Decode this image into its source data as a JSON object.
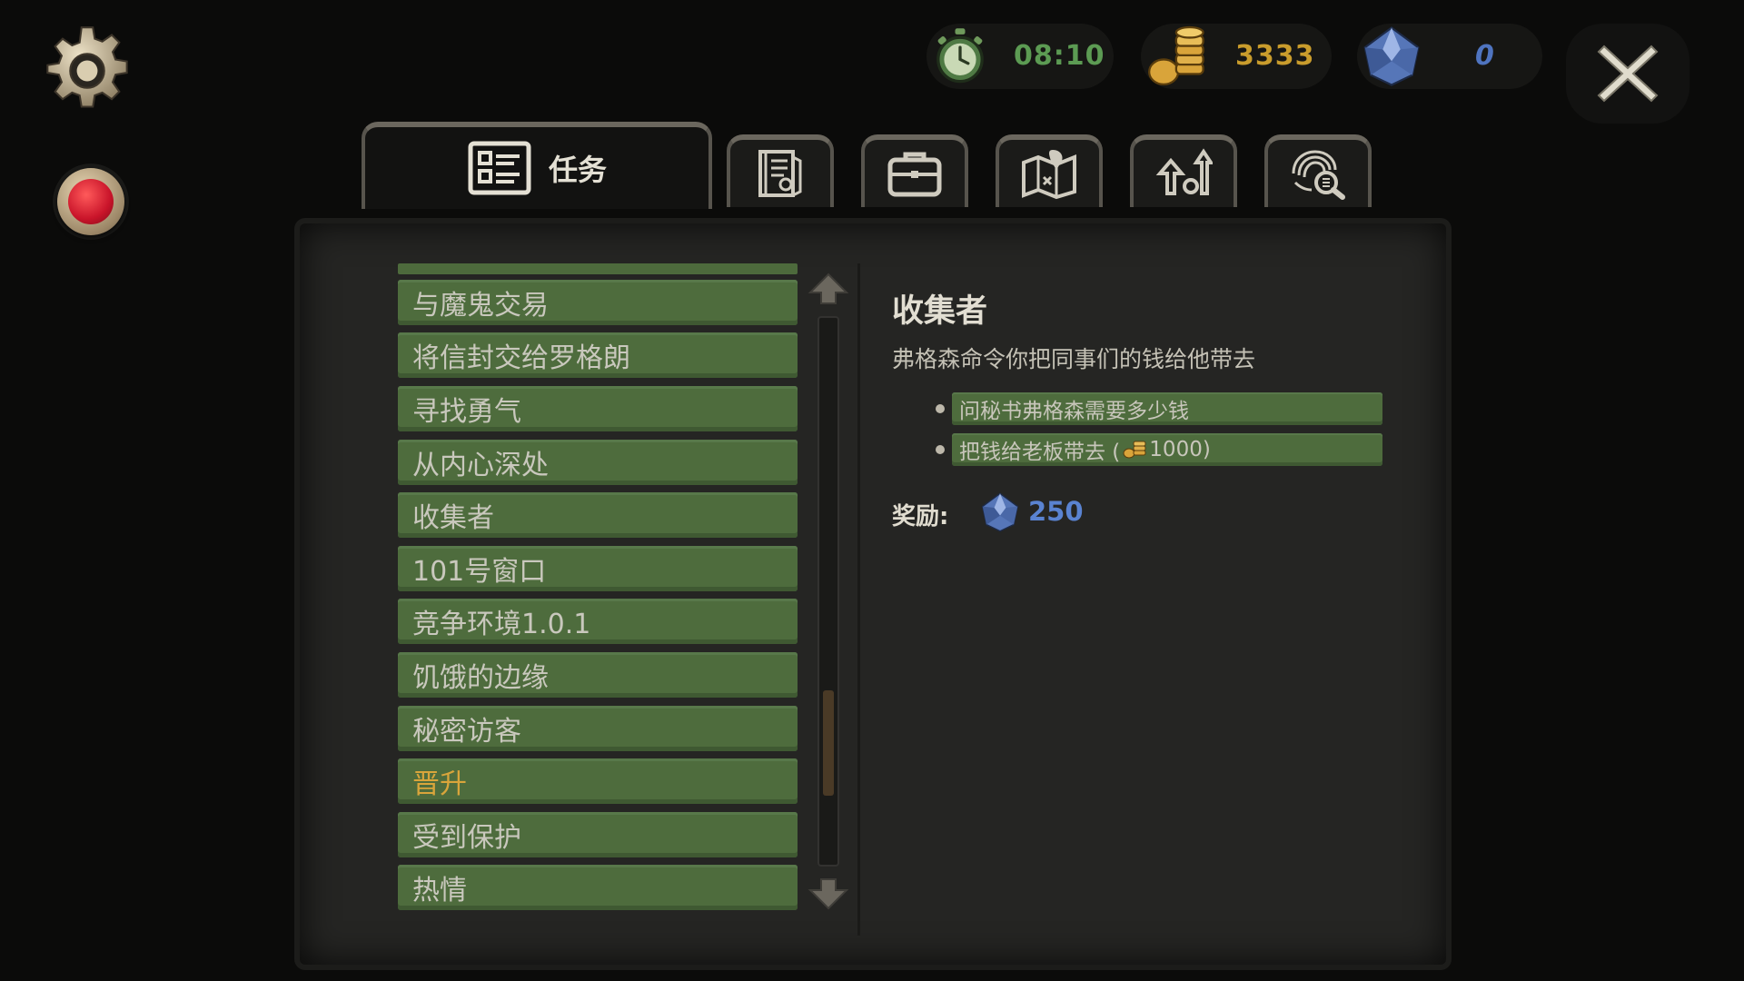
{
  "hud": {
    "time": "08:10",
    "gold": "3333",
    "gems": "0"
  },
  "tabs": [
    {
      "label": "任务",
      "icon": "task-list-icon",
      "active": true
    },
    {
      "label": "",
      "icon": "notes-icon",
      "active": false
    },
    {
      "label": "",
      "icon": "briefcase-icon",
      "active": false
    },
    {
      "label": "",
      "icon": "map-icon",
      "active": false
    },
    {
      "label": "",
      "icon": "upgrade-icon",
      "active": false
    },
    {
      "label": "",
      "icon": "fingerprint-search-icon",
      "active": false
    }
  ],
  "quests": [
    {
      "label": "与魔鬼交易",
      "active": false
    },
    {
      "label": "将信封交给罗格朗",
      "active": false
    },
    {
      "label": "寻找勇气",
      "active": false
    },
    {
      "label": "从内心深处",
      "active": false
    },
    {
      "label": "收集者",
      "active": false
    },
    {
      "label": "101号窗口",
      "active": false
    },
    {
      "label": "竞争环境1.0.1",
      "active": false
    },
    {
      "label": "饥饿的边缘",
      "active": false
    },
    {
      "label": "秘密访客",
      "active": false
    },
    {
      "label": "晋升",
      "active": true
    },
    {
      "label": "受到保护",
      "active": false
    },
    {
      "label": "热情",
      "active": false
    }
  ],
  "detail": {
    "title": "收集者",
    "description": "弗格森命令你把同事们的钱给他带去",
    "objectives": [
      {
        "text": "问秘书弗格森需要多少钱"
      },
      {
        "text_before": "把钱给老板带去 (",
        "amount": "1000",
        "text_after": ")"
      }
    ],
    "reward_label": "奖励:",
    "reward_value": "250"
  },
  "colors": {
    "quest_green": "#4e6c3d",
    "active_quest_text": "#d9a53b",
    "time_green": "#5c9b53",
    "gold": "#c99c2c",
    "gem_blue": "#4f74c0"
  }
}
